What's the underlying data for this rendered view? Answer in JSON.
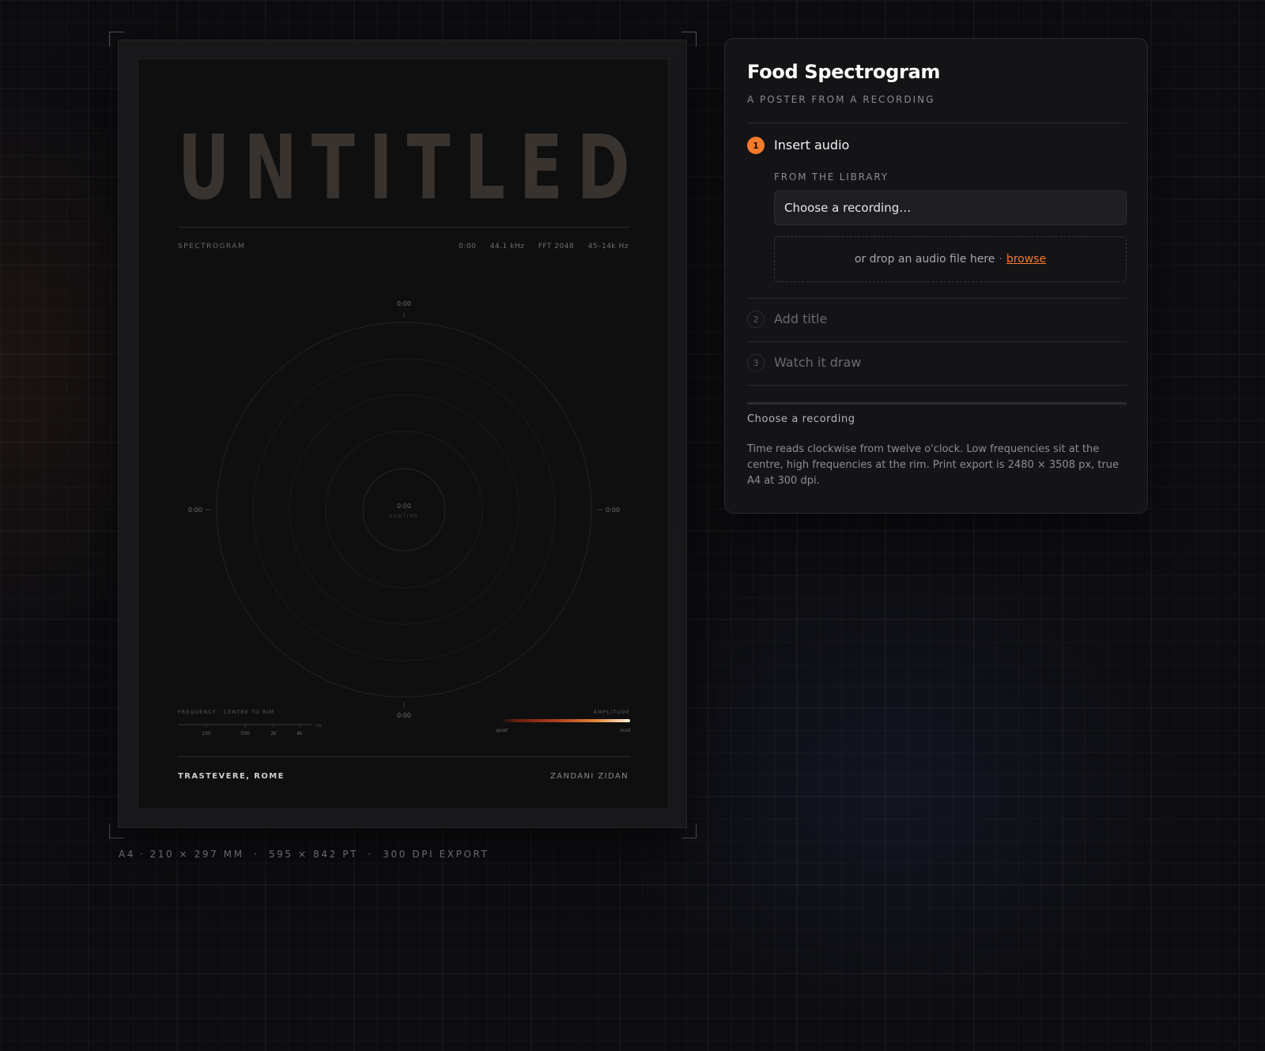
{
  "poster": {
    "title_letters": [
      "U",
      "N",
      "T",
      "I",
      "T",
      "L",
      "E",
      "D"
    ],
    "section_label": "SPECTROGRAM",
    "meta": {
      "time": "0:00",
      "sample_rate": "44.1 kHz",
      "fft": "FFT 2048",
      "freq_range": "45–14k Hz"
    },
    "dial": {
      "top": "0:00",
      "right": "0:00",
      "bottom": "0:00",
      "left": "0:00",
      "center_time": "0:00",
      "center_label": "RUNTIME"
    },
    "frequency_legend": {
      "label": "FREQUENCY · CENTRE TO RIM",
      "unit": "Hz",
      "ticks": [
        "100",
        "500",
        "2k",
        "8k"
      ]
    },
    "amplitude_legend": {
      "label": "AMPLITUDE",
      "low": "quiet",
      "high": "loud"
    },
    "location": "TRASTEVERE, ROME",
    "author": "ZANDANI ZIDAN"
  },
  "spec_caption": [
    "A4",
    "210 × 297 MM",
    "595 × 842 PT",
    "300 DPI EXPORT"
  ],
  "panel": {
    "title": "Food Spectrogram",
    "subtitle": "A POSTER FROM A RECORDING",
    "steps": [
      {
        "number": "1",
        "label": "Insert audio",
        "state": "active"
      },
      {
        "number": "2",
        "label": "Add title",
        "state": "idle"
      },
      {
        "number": "3",
        "label": "Watch it draw",
        "state": "idle"
      }
    ],
    "library_label": "FROM THE LIBRARY",
    "select_value": "Choose a recording…",
    "drop_text": "or drop an audio file here",
    "drop_separator": "·",
    "browse_label": "browse",
    "progress": 0,
    "status": "Choose a recording",
    "description": "Time reads clockwise from twelve o'clock. Low frequencies sit at the centre, high frequencies at the rim. Print export is 2480 × 3508 px, true A4 at 300 dpi."
  },
  "colors": {
    "accent": "#f47a2c",
    "background": "#0d0d10",
    "panel": "#141417",
    "poster": "#0f0f10",
    "title_ink": "#38332f"
  }
}
